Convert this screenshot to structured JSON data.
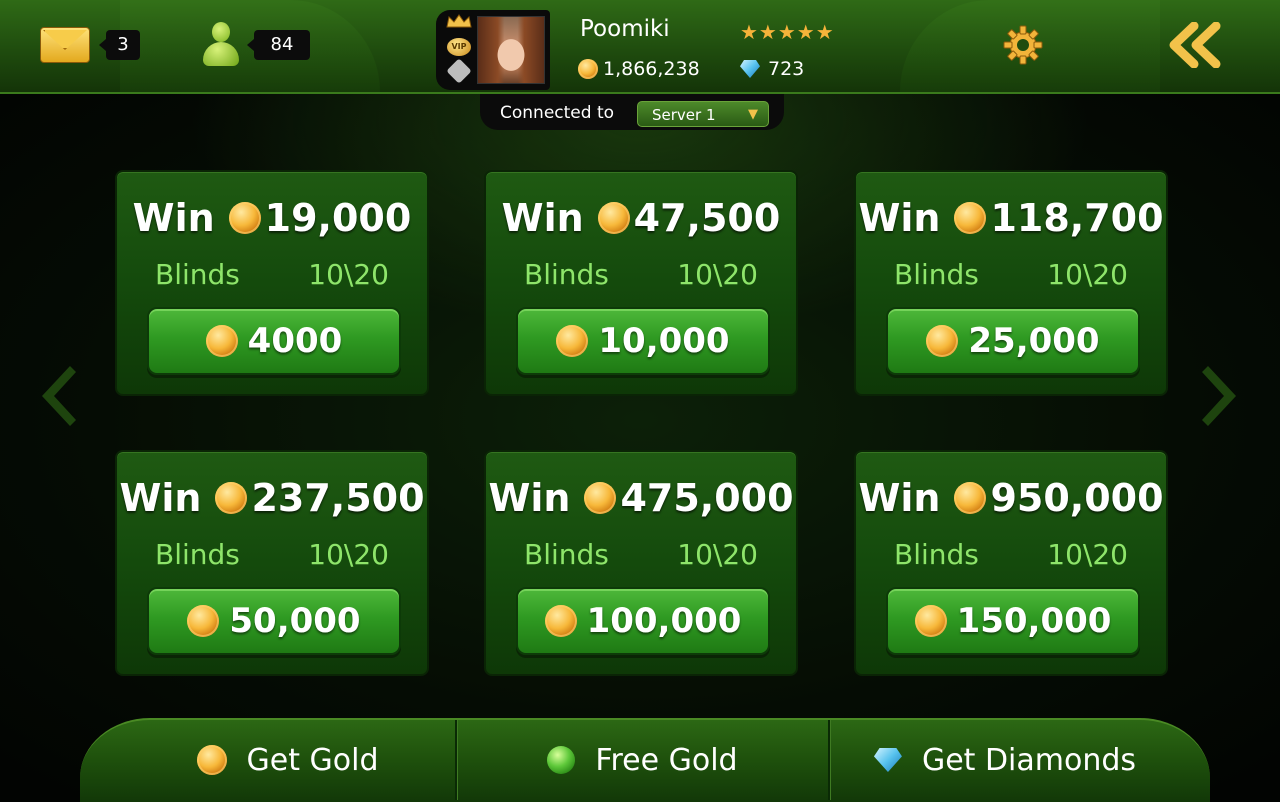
{
  "header": {
    "messages_count": "3",
    "friends_count": "84",
    "username": "Poomiki",
    "stars": "★★★★★",
    "gold": "1,866,238",
    "diamonds": "723",
    "vip_label": "VIP"
  },
  "server": {
    "label": "Connected to",
    "selected": "Server 1"
  },
  "tables": [
    {
      "win_label": "Win",
      "win_amount": "19,000",
      "blinds_label": "Blinds",
      "blinds": "10\\20",
      "buy_in": "4000"
    },
    {
      "win_label": "Win",
      "win_amount": "47,500",
      "blinds_label": "Blinds",
      "blinds": "10\\20",
      "buy_in": "10,000"
    },
    {
      "win_label": "Win",
      "win_amount": "118,700",
      "blinds_label": "Blinds",
      "blinds": "10\\20",
      "buy_in": "25,000"
    },
    {
      "win_label": "Win",
      "win_amount": "237,500",
      "blinds_label": "Blinds",
      "blinds": "10\\20",
      "buy_in": "50,000"
    },
    {
      "win_label": "Win",
      "win_amount": "475,000",
      "blinds_label": "Blinds",
      "blinds": "10\\20",
      "buy_in": "100,000"
    },
    {
      "win_label": "Win",
      "win_amount": "950,000",
      "blinds_label": "Blinds",
      "blinds": "10\\20",
      "buy_in": "150,000"
    }
  ],
  "footer": {
    "get_gold": "Get Gold",
    "free_gold": "Free Gold",
    "get_diamonds": "Get Diamonds"
  },
  "icons": {
    "mail": "envelope-icon",
    "friends": "person-icon",
    "settings": "gear-icon",
    "back": "double-chevron-left-icon",
    "coin": "gold-coin-icon",
    "diamond": "diamond-icon"
  },
  "colors": {
    "accent_green": "#2f9a22",
    "blinds_text": "#8ee56a",
    "coin_gold": "#f7b83a",
    "diamond_blue": "#58c3ee"
  }
}
